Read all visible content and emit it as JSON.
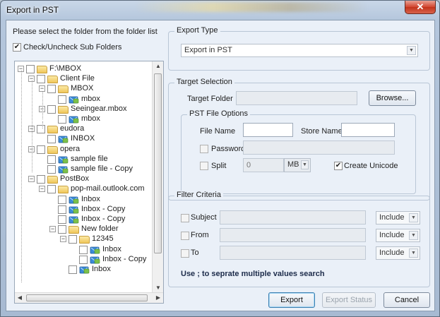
{
  "window": {
    "title": "Export in PST",
    "close_glyph": "✕"
  },
  "left": {
    "instruction": "Please select the folder from the folder list",
    "subfolders_label": "Check/Uncheck Sub Folders",
    "subfolders_checked": true
  },
  "tree": [
    {
      "label": "F:\\MBOX",
      "icon": "folder-icon",
      "level": 0,
      "expand": "⊟"
    },
    {
      "label": "Client File",
      "icon": "folder-icon",
      "level": 1,
      "expand": "⊟"
    },
    {
      "label": "MBOX",
      "icon": "folder-icon",
      "level": 2,
      "expand": "⊟"
    },
    {
      "label": "mbox",
      "icon": "mail-file-icon",
      "level": 3,
      "expand": ""
    },
    {
      "label": "Seeingear.mbox",
      "icon": "folder-icon",
      "level": 2,
      "expand": "⊟"
    },
    {
      "label": "mbox",
      "icon": "mail-file-icon",
      "level": 3,
      "expand": ""
    },
    {
      "label": "eudora",
      "icon": "folder-icon",
      "level": 1,
      "expand": "⊟"
    },
    {
      "label": "INBOX",
      "icon": "mail-file-icon",
      "level": 2,
      "expand": ""
    },
    {
      "label": "opera",
      "icon": "folder-icon",
      "level": 1,
      "expand": "⊟"
    },
    {
      "label": "sample file",
      "icon": "mail-file-icon",
      "level": 2,
      "expand": ""
    },
    {
      "label": "sample file - Copy",
      "icon": "mail-file-icon",
      "level": 2,
      "expand": ""
    },
    {
      "label": "PostBox",
      "icon": "folder-icon",
      "level": 1,
      "expand": "⊟"
    },
    {
      "label": "pop-mail.outlook.com",
      "icon": "folder-icon",
      "level": 2,
      "expand": "⊟"
    },
    {
      "label": "Inbox",
      "icon": "mail-file-icon",
      "level": 3,
      "expand": ""
    },
    {
      "label": "Inbox - Copy",
      "icon": "mail-file-icon",
      "level": 3,
      "expand": ""
    },
    {
      "label": "Inbox - Copy",
      "icon": "mail-file-icon",
      "level": 3,
      "expand": ""
    },
    {
      "label": "New folder",
      "icon": "folder-icon",
      "level": 3,
      "expand": "⊟"
    },
    {
      "label": "12345",
      "icon": "folder-icon",
      "level": 4,
      "expand": "⊟"
    },
    {
      "label": "Inbox",
      "icon": "mail-file-icon",
      "level": 5,
      "expand": ""
    },
    {
      "label": "Inbox - Copy",
      "icon": "mail-file-icon",
      "level": 5,
      "expand": ""
    },
    {
      "label": "Inbox",
      "icon": "mail-file-icon",
      "level": 4,
      "expand": ""
    }
  ],
  "export_type": {
    "title": "Export Type",
    "selected": "Export in PST"
  },
  "target": {
    "title": "Target Selection",
    "folder_label": "Target Folder",
    "folder_value": "",
    "browse_label": "Browse..."
  },
  "pst_options": {
    "title": "PST File Options",
    "file_name_label": "File Name",
    "file_name_value": "",
    "store_name_label": "Store Name",
    "store_name_value": "",
    "password_label": "Password",
    "password_checked": false,
    "password_value": "",
    "split_label": "Split",
    "split_checked": false,
    "split_value": "0",
    "split_unit": "MB",
    "unicode_label": "Create Unicode",
    "unicode_checked": true
  },
  "filter": {
    "title": "Filter Criteria",
    "rows": [
      {
        "label": "Subject",
        "value": "",
        "mode": "Include"
      },
      {
        "label": "From",
        "value": "",
        "mode": "Include"
      },
      {
        "label": "To",
        "value": "",
        "mode": "Include"
      }
    ],
    "hint": "Use ; to seprate multiple values search"
  },
  "buttons": {
    "export": "Export",
    "export_status": "Export Status",
    "cancel": "Cancel"
  },
  "colors": {
    "accent": "#3c7fb1",
    "panel": "#eaf0f8",
    "frame": "#b4c6dc"
  }
}
